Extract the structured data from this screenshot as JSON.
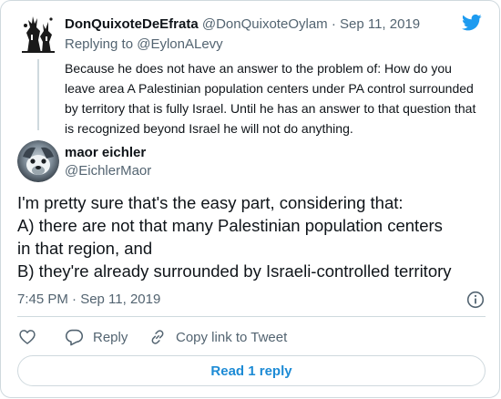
{
  "parent": {
    "name": "DonQuixoteDeEfrata",
    "handle": "@DonQuixoteOylam",
    "separator": "·",
    "date": "Sep 11, 2019",
    "replying_prefix": "Replying to",
    "replying_to": "@EylonALevy",
    "text": "Because he does not have an answer to the problem of: How do you leave area A Palestinian population centers under PA control surrounded by territory that is fully Israel.  Until he has an answer to that question that is recognized beyond Israel he will not do anything."
  },
  "tweet": {
    "name": "maor eichler",
    "handle": "@EichlerMaor",
    "lines": [
      "I'm pretty sure that's the easy part, considering that:",
      "A) there are not that many Palestinian population centers",
      "in that region, and",
      "B) they're already surrounded by Israeli-controlled territory"
    ],
    "timestamp": "7:45 PM · Sep 11, 2019"
  },
  "actions": {
    "reply_label": "Reply",
    "copy_label": "Copy link to Tweet",
    "read_replies_label": "Read 1 reply"
  },
  "colors": {
    "brand": "#1d9bf0",
    "link_button_text": "#1d8bd5",
    "secondary_text": "#536471",
    "border": "#cfd9de"
  },
  "icons": [
    "twitter-bird-icon",
    "info-icon",
    "heart-icon",
    "reply-icon",
    "link-icon"
  ]
}
